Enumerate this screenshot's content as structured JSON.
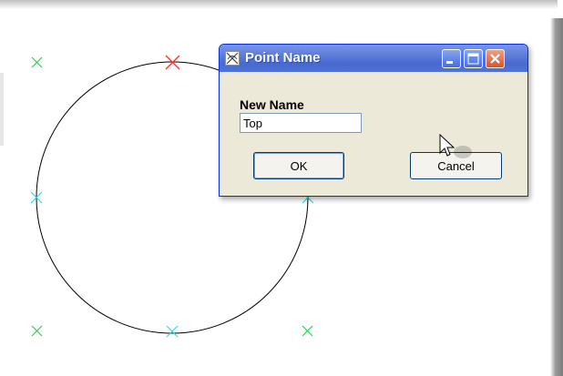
{
  "dialog": {
    "title": "Point Name",
    "label": "New Name",
    "input_value": "Top",
    "ok_label": "OK",
    "cancel_label": "Cancel"
  },
  "icons": [
    "title-app-icon",
    "minimize-icon",
    "maximize-icon",
    "close-icon",
    "mouse-cursor-icon"
  ],
  "colors": {
    "selected_point": "#ff3333",
    "point_green": "#33cc55",
    "point_cyan": "#33dddd",
    "circle": "#000000",
    "titlebar": "#4d6fd9"
  }
}
